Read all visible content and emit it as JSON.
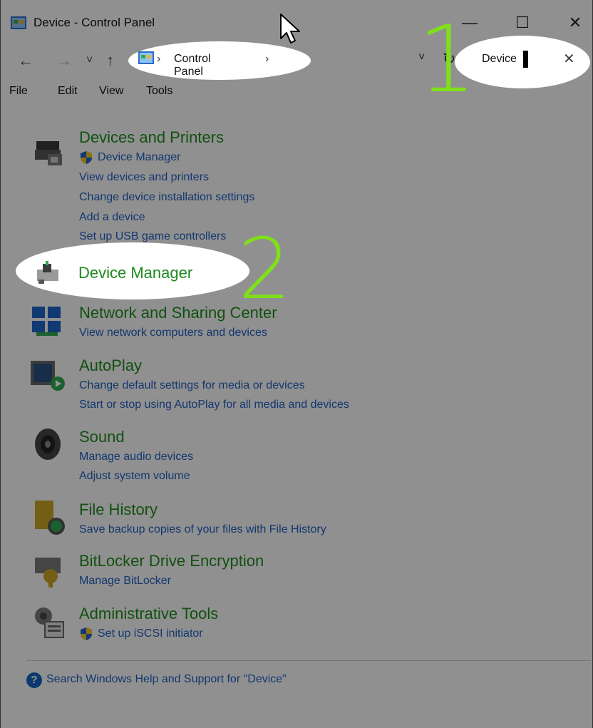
{
  "window": {
    "title": "Device - Control Panel",
    "minimize": "—",
    "maximize": "☐",
    "close": "✕"
  },
  "nav": {
    "back": "←",
    "forward": "→",
    "recent": "˅",
    "up": "↑",
    "refresh": "↻",
    "dropdown": "˅"
  },
  "address": {
    "crumb": "Control Panel",
    "sep": "›"
  },
  "search": {
    "value": "Device",
    "clear": "✕"
  },
  "menu": {
    "items": [
      "File",
      "Edit",
      "View",
      "Tools"
    ]
  },
  "results": [
    {
      "title": "Devices and Printers",
      "tasks": [
        "Device Manager",
        "View devices and printers",
        "Change device installation settings",
        "Add a device",
        "Set up USB game controllers"
      ],
      "shielded": [
        0
      ]
    },
    {
      "title": "Device Manager",
      "tasks": [],
      "shielded": []
    },
    {
      "title": "Network and Sharing Center",
      "tasks": [
        "View network computers and devices"
      ],
      "shielded": []
    },
    {
      "title": "AutoPlay",
      "tasks": [
        "Change default settings for media or devices",
        "Start or stop using AutoPlay for all media and devices"
      ],
      "shielded": []
    },
    {
      "title": "Sound",
      "tasks": [
        "Manage audio devices",
        "Adjust system volume"
      ],
      "shielded": []
    },
    {
      "title": "File History",
      "tasks": [
        "Save backup copies of your files with File History"
      ],
      "shielded": []
    },
    {
      "title": "BitLocker Drive Encryption",
      "tasks": [
        "Manage BitLocker"
      ],
      "shielded": []
    },
    {
      "title": "Administrative Tools",
      "tasks": [
        "Set up iSCSI initiator"
      ],
      "shielded": [
        0
      ]
    }
  ],
  "help": {
    "text": "Search Windows Help and Support for \"Device\"",
    "icon": "?"
  },
  "annotations": {
    "step1": "1",
    "step2": "2"
  },
  "colors": {
    "category": "#1e8a1e",
    "task": "#1f5fbf",
    "annotation": "#7fe01a"
  }
}
